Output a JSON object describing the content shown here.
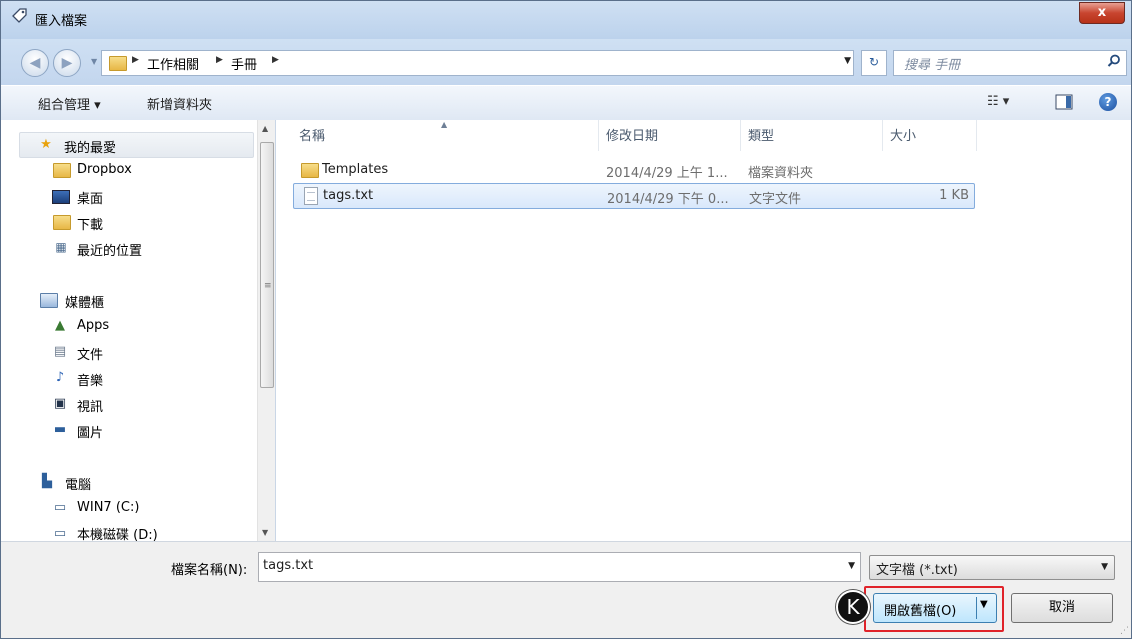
{
  "window": {
    "title": "匯入檔案",
    "close_label": "x"
  },
  "address": {
    "breadcrumbs": [
      "工作相關",
      "手冊"
    ],
    "search_placeholder": "搜尋 手冊"
  },
  "toolbar": {
    "organize_label": "組合管理 ▾",
    "new_folder_label": "新增資料夾",
    "view_menu_label": "☷ ▾"
  },
  "nav": {
    "favorites": {
      "label": "我的最愛",
      "items": [
        {
          "label": "Dropbox",
          "icon": "folder-icon"
        },
        {
          "label": "桌面",
          "icon": "desktop-icon"
        },
        {
          "label": "下載",
          "icon": "downloads-icon"
        },
        {
          "label": "最近的位置",
          "icon": "recent-places-icon"
        }
      ]
    },
    "libraries": {
      "label": "媒體櫃",
      "items": [
        {
          "label": "Apps",
          "icon": "apps-icon"
        },
        {
          "label": "文件",
          "icon": "documents-icon"
        },
        {
          "label": "音樂",
          "icon": "music-icon"
        },
        {
          "label": "視訊",
          "icon": "video-icon"
        },
        {
          "label": "圖片",
          "icon": "pictures-icon"
        }
      ]
    },
    "computer": {
      "label": "電腦",
      "items": [
        {
          "label": "WIN7 (C:)",
          "icon": "drive-icon"
        },
        {
          "label": "本機磁碟 (D:)",
          "icon": "drive-icon"
        }
      ]
    }
  },
  "files": {
    "columns": [
      "名稱",
      "修改日期",
      "類型",
      "大小"
    ],
    "rows": [
      {
        "name": "Templates",
        "modified": "2014/4/29 上午 1...",
        "type": "檔案資料夾",
        "size": "",
        "icon": "folder-icon",
        "selected": false
      },
      {
        "name": "tags.txt",
        "modified": "2014/4/29 下午 0...",
        "type": "文字文件",
        "size": "1 KB",
        "icon": "text-file-icon",
        "selected": true
      }
    ]
  },
  "bottom": {
    "filename_label": "檔案名稱(N):",
    "filename_value": "tags.txt",
    "filetype_value": "文字檔 (*.txt)",
    "open_label": "開啟舊檔(O)",
    "cancel_label": "取消",
    "step_badge": "K"
  },
  "colors": {
    "highlight_border": "#e0232a",
    "selection_fill": "#d9e8fb",
    "selection_border": "#84acdd",
    "title_gradient": "#cfe0f3"
  }
}
